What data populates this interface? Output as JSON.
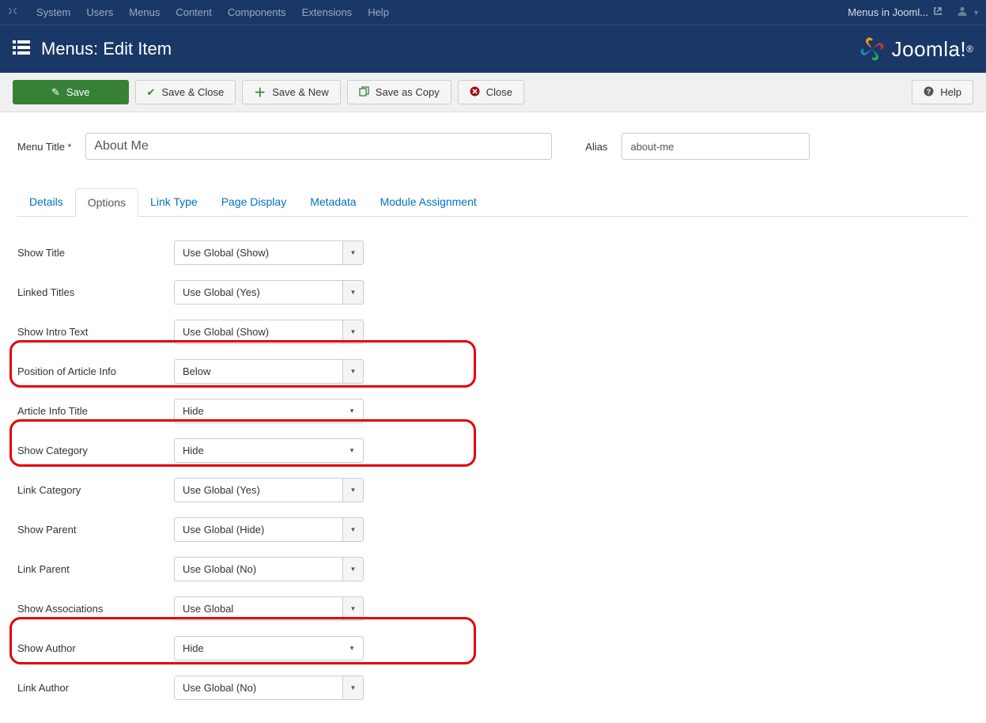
{
  "topnav": {
    "items": [
      "System",
      "Users",
      "Menus",
      "Content",
      "Components",
      "Extensions",
      "Help"
    ],
    "right_label": "Menus in Jooml..."
  },
  "header": {
    "title": "Menus: Edit Item",
    "brand": "Joomla!"
  },
  "toolbar": {
    "save": "Save",
    "save_close": "Save & Close",
    "save_new": "Save & New",
    "save_copy": "Save as Copy",
    "close": "Close",
    "help": "Help"
  },
  "form": {
    "menu_title_label": "Menu Title",
    "menu_title_value": "About Me",
    "alias_label": "Alias",
    "alias_value": "about-me"
  },
  "tabs": [
    "Details",
    "Options",
    "Link Type",
    "Page Display",
    "Metadata",
    "Module Assignment"
  ],
  "options": [
    {
      "label": "Show Title",
      "value": "Use Global (Show)",
      "kind": "split",
      "highlight": false
    },
    {
      "label": "Linked Titles",
      "value": "Use Global (Yes)",
      "kind": "split",
      "highlight": false
    },
    {
      "label": "Show Intro Text",
      "value": "Use Global (Show)",
      "kind": "split",
      "highlight": false
    },
    {
      "label": "Position of Article Info",
      "value": "Below",
      "kind": "split",
      "highlight": true
    },
    {
      "label": "Article Info Title",
      "value": "Hide",
      "kind": "plain",
      "highlight": false
    },
    {
      "label": "Show Category",
      "value": "Hide",
      "kind": "plain",
      "highlight": true
    },
    {
      "label": "Link Category",
      "value": "Use Global (Yes)",
      "kind": "split",
      "highlight": false
    },
    {
      "label": "Show Parent",
      "value": "Use Global (Hide)",
      "kind": "split",
      "highlight": false
    },
    {
      "label": "Link Parent",
      "value": "Use Global (No)",
      "kind": "split",
      "highlight": false
    },
    {
      "label": "Show Associations",
      "value": "Use Global",
      "kind": "split",
      "highlight": false
    },
    {
      "label": "Show Author",
      "value": "Hide",
      "kind": "plain",
      "highlight": true
    },
    {
      "label": "Link Author",
      "value": "Use Global (No)",
      "kind": "split",
      "highlight": false
    }
  ]
}
